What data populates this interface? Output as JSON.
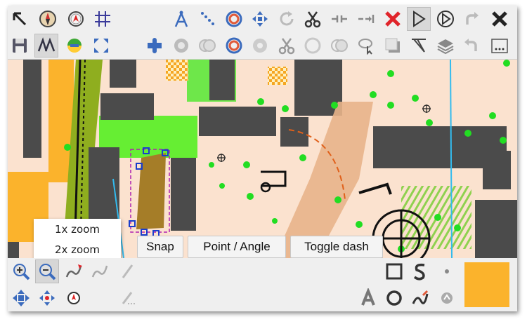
{
  "toolbar_top": [
    {
      "id": "select-arrow",
      "label": "Select"
    },
    {
      "id": "compass",
      "label": "Compass"
    },
    {
      "id": "gps",
      "label": "GPS"
    },
    {
      "id": "grid",
      "label": "Grid"
    },
    {
      "id": "compass-tool",
      "label": "Measure"
    },
    {
      "id": "dotted-line",
      "label": "Dash points"
    },
    {
      "id": "circle-tool",
      "label": "Circle"
    },
    {
      "id": "move",
      "label": "Move"
    },
    {
      "id": "rotate",
      "label": "Rotate"
    },
    {
      "id": "cut",
      "label": "Cut"
    },
    {
      "id": "gap",
      "label": "Gap"
    },
    {
      "id": "connect",
      "label": "Connect"
    },
    {
      "id": "delete",
      "label": "Delete"
    },
    {
      "id": "draw-triangle",
      "label": "Draw"
    },
    {
      "id": "rotate-pattern",
      "label": "Rotate pattern"
    },
    {
      "id": "redo",
      "label": "Redo"
    },
    {
      "id": "close",
      "label": "Close"
    }
  ],
  "toolbar_second": [
    {
      "id": "save",
      "label": "Save"
    },
    {
      "id": "symbols",
      "label": "Symbols"
    },
    {
      "id": "templates",
      "label": "Templates"
    },
    {
      "id": "fullscreen",
      "label": "Full screen"
    },
    {
      "id": "puzzle",
      "label": "Tags"
    },
    {
      "id": "fill",
      "label": "Fill"
    },
    {
      "id": "unify",
      "label": "Unify"
    },
    {
      "id": "ring",
      "label": "Ring"
    },
    {
      "id": "cut-hole",
      "label": "Cut hole"
    },
    {
      "id": "split",
      "label": "Split"
    },
    {
      "id": "circle-outline",
      "label": "Circle"
    },
    {
      "id": "intersect",
      "label": "Intersect"
    },
    {
      "id": "lasso",
      "label": "Lasso"
    },
    {
      "id": "duplicate",
      "label": "Duplicate"
    },
    {
      "id": "triangle-tool",
      "label": "Triangle"
    },
    {
      "id": "layers",
      "label": "Layers"
    },
    {
      "id": "undo",
      "label": "Undo"
    },
    {
      "id": "more",
      "label": "More"
    }
  ],
  "zoom_menu": {
    "items": [
      "1x zoom",
      "2x zoom"
    ]
  },
  "map_buttons": {
    "snap": "Snap",
    "point_angle": "Point / Angle",
    "toggle_dash": "Toggle dash"
  },
  "bottom_bar": {
    "zoom_in": "zoom-in-icon",
    "zoom_out": "zoom-out-icon",
    "color": "#fbb32c"
  },
  "colors": {
    "accent_blue": "#1a66cc",
    "map_bg": "#fbe2cf",
    "building": "#4b4b4b",
    "green": "#22dd22",
    "olive": "#8fae1f"
  }
}
